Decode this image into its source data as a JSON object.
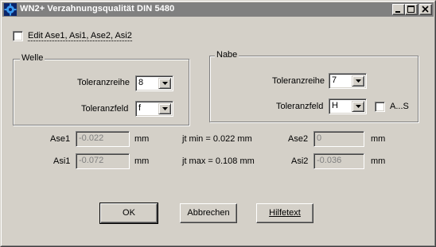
{
  "window": {
    "title": "WN2+ Verzahnungsqualität DIN 5480",
    "titlebar_color": "#808080",
    "icon": "gear-app-icon"
  },
  "edit_checkbox": {
    "label": "Edit Ase1, Asi1, Ase2, Asi2",
    "checked": false
  },
  "welle": {
    "title": "Welle",
    "toleranzreihe_label": "Toleranzreihe",
    "toleranzreihe_value": "8",
    "toleranzfeld_label": "Toleranzfeld",
    "toleranzfeld_value": "f"
  },
  "nabe": {
    "title": "Nabe",
    "toleranzreihe_label": "Toleranzreihe",
    "toleranzreihe_value": "7",
    "toleranzfeld_label": "Toleranzfeld",
    "toleranzfeld_value": "H",
    "as_checkbox_label": "A...S",
    "as_checked": false
  },
  "values": {
    "ase1_label": "Ase1",
    "ase1_value": "-0.022",
    "asi1_label": "Asi1",
    "asi1_value": "-0.072",
    "ase2_label": "Ase2",
    "ase2_value": "0",
    "asi2_label": "Asi2",
    "asi2_value": "-0.036",
    "unit": "mm",
    "jt_min": "jt min = 0.022 mm",
    "jt_max": "jt max = 0.108 mm"
  },
  "buttons": {
    "ok": "OK",
    "cancel": "Abbrechen",
    "help": "Hilfetext"
  }
}
